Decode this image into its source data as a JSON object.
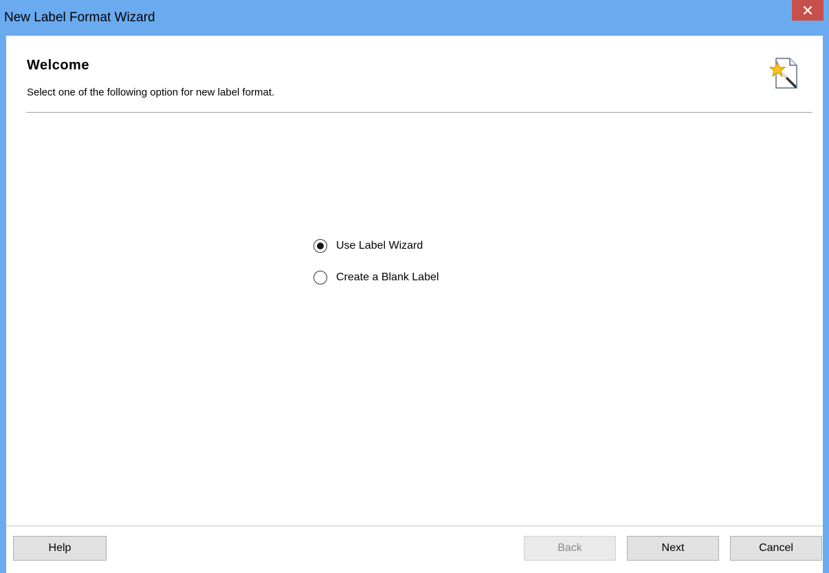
{
  "window": {
    "title": "New Label Format Wizard"
  },
  "header": {
    "heading": "Welcome",
    "subheading": "Select one of the following option for new label format.",
    "icon": "label-wizard-icon"
  },
  "options": [
    {
      "label": "Use Label Wizard",
      "selected": true
    },
    {
      "label": "Create a Blank Label",
      "selected": false
    }
  ],
  "buttons": {
    "help": "Help",
    "back": "Back",
    "next": "Next",
    "cancel": "Cancel"
  },
  "colors": {
    "titlebar": "#6aabf0",
    "close": "#c7504b"
  }
}
